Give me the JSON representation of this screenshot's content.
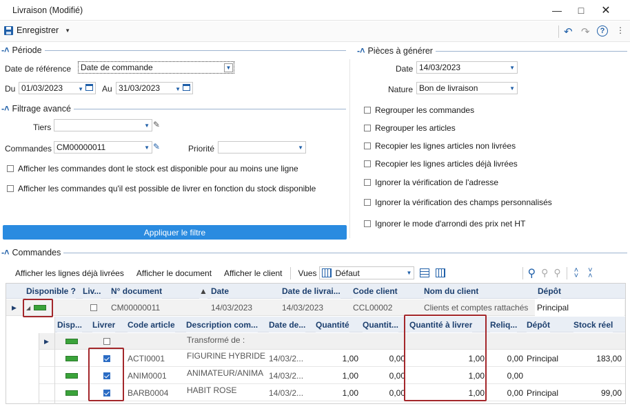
{
  "window": {
    "title": "Livraison (Modifié)"
  },
  "toolbar": {
    "save_label": "Enregistrer"
  },
  "periode": {
    "title": "Période",
    "date_ref_label": "Date de référence",
    "date_ref_value": "Date de commande",
    "du_label": "Du",
    "du_value": "01/03/2023",
    "au_label": "Au",
    "au_value": "31/03/2023"
  },
  "filtrage": {
    "title": "Filtrage avancé",
    "tiers_label": "Tiers",
    "tiers_value": "",
    "commandes_label": "Commandes",
    "commandes_value": "CM00000011",
    "priorite_label": "Priorité",
    "priorite_value": "",
    "cb1": "Afficher les commandes dont le stock est disponible pour au moins une ligne",
    "cb2": "Afficher les commandes qu'il est possible de livrer en fonction du stock disponible"
  },
  "apply_label": "Appliquer le filtre",
  "pieces": {
    "title": "Pièces à générer",
    "date_label": "Date",
    "date_value": "14/03/2023",
    "nature_label": "Nature",
    "nature_value": "Bon de livraison",
    "options": [
      "Regrouper les commandes",
      "Regrouper les articles",
      "Recopier les lignes articles non livrées",
      "Recopier les lignes articles déjà livrées",
      "Ignorer la vérification de l'adresse",
      "Ignorer la vérification des champs personnalisés",
      "Ignorer le mode d'arrondi des prix net HT"
    ]
  },
  "commandes": {
    "title": "Commandes",
    "tb": {
      "a1": "Afficher les lignes déjà livrées",
      "a2": "Afficher le document",
      "a3": "Afficher le client",
      "vues_label": "Vues",
      "vues_value": "Défaut"
    },
    "headers": {
      "dispo": "Disponible ?",
      "liv": "Liv...",
      "ndoc": "N° document",
      "date": "Date",
      "datelivr": "Date de livrai...",
      "codeclient": "Code client",
      "nomclient": "Nom du client",
      "depot": "Dépôt"
    },
    "order": {
      "ndoc": "CM00000011",
      "date": "14/03/2023",
      "datelivr": "14/03/2023",
      "codeclient": "CCL00002",
      "nomclient": "Clients et comptes rattachés",
      "depot": "Principal"
    },
    "sub_headers": {
      "dispo": "Disp...",
      "livrer": "Livrer",
      "code": "Code article",
      "desc": "Description com...",
      "date": "Date de...",
      "qte": "Quantité",
      "qte2": "Quantit...",
      "qteliv": "Quantité à livrer",
      "reliq": "Reliq...",
      "depot": "Dépôt",
      "stock": "Stock réel"
    },
    "sub_first": "Transformé de :",
    "lines": [
      {
        "code": "ACTI0001",
        "desc": "FIGURINE HYBRIDE",
        "date": "14/03/2...",
        "qte": "1,00",
        "qte2": "0,00",
        "qteliv": "1,00",
        "reliq": "0,00",
        "depot": "Principal",
        "stock": "183,00"
      },
      {
        "code": "ANIM0001",
        "desc": "ANIMATEUR/ANIMA",
        "date": "14/03/2...",
        "qte": "1,00",
        "qte2": "0,00",
        "qteliv": "1,00",
        "reliq": "0,00",
        "depot": "",
        "stock": ""
      },
      {
        "code": "BARB0004",
        "desc": "HABIT ROSE",
        "date": "14/03/2...",
        "qte": "1,00",
        "qte2": "0,00",
        "qteliv": "1,00",
        "reliq": "0,00",
        "depot": "Principal",
        "stock": "99,00"
      }
    ]
  }
}
